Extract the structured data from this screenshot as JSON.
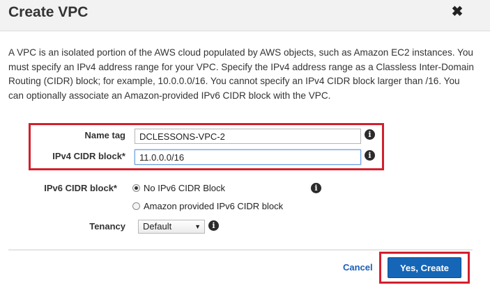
{
  "dialog": {
    "title": "Create VPC",
    "close_glyph": "✖",
    "description": "A VPC is an isolated portion of the AWS cloud populated by AWS objects, such as Amazon EC2 instances. You must specify an IPv4 address range for your VPC. Specify the IPv4 address range as a Classless Inter-Domain Routing (CIDR) block; for example, 10.0.0.0/16. You cannot specify an IPv4 CIDR block larger than /16. You can optionally associate an Amazon-provided IPv6 CIDR block with the VPC."
  },
  "form": {
    "name_tag": {
      "label": "Name tag",
      "value": "DCLESSONS-VPC-2"
    },
    "ipv4_cidr": {
      "label": "IPv4 CIDR block*",
      "value": "11.0.0.0/16"
    },
    "ipv6_cidr": {
      "label": "IPv6 CIDR block*",
      "options": [
        {
          "label": "No IPv6 CIDR Block",
          "checked": true
        },
        {
          "label": "Amazon provided IPv6 CIDR block",
          "checked": false
        }
      ]
    },
    "tenancy": {
      "label": "Tenancy",
      "selected": "Default"
    },
    "info_glyph": "i"
  },
  "footer": {
    "cancel_label": "Cancel",
    "create_label": "Yes, Create"
  },
  "colors": {
    "highlight_border": "#d31f2c",
    "primary_button": "#1566b7",
    "link": "#1a5fb4"
  },
  "icons": [
    "close-icon",
    "info-icon",
    "dropdown-arrow-icon"
  ]
}
